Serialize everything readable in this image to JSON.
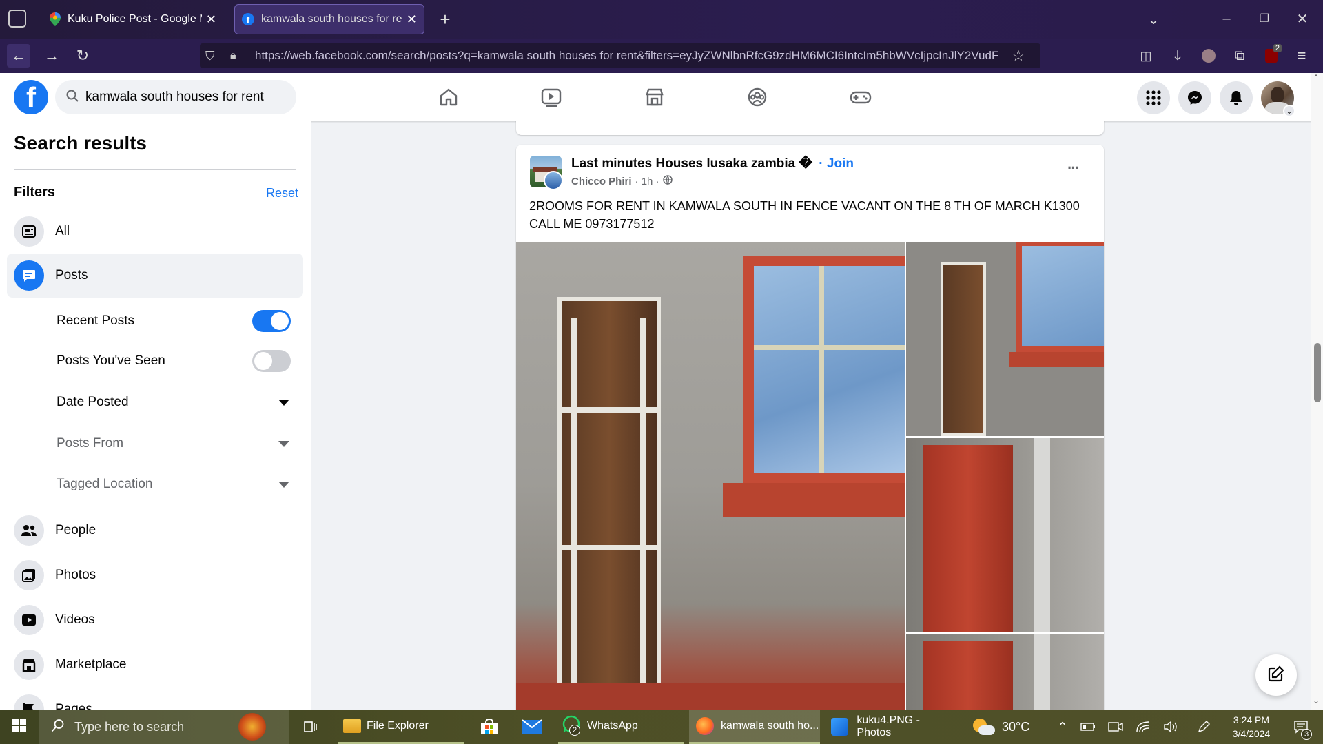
{
  "browser": {
    "tabs": [
      {
        "title": "Kuku Police Post - Google Maps",
        "icon": "google-maps-icon"
      },
      {
        "title": "kamwala south houses for rent",
        "icon": "facebook-icon"
      }
    ],
    "url": "https://web.facebook.com/search/posts?q=kamwala south houses for rent&filters=eyJyZWNlbnRfcG9zdHM6MCI6IntcIm5hbWVcIjpcInJlY2VudF",
    "url_host": "web.facebook.com",
    "extension_badge": "2"
  },
  "facebook": {
    "search_value": "kamwala south houses for rent",
    "nav_icons": [
      "home-icon",
      "watch-icon",
      "marketplace-icon",
      "groups-icon",
      "gaming-icon"
    ]
  },
  "sidebar": {
    "title": "Search results",
    "filters_label": "Filters",
    "reset_label": "Reset",
    "categories": {
      "all": "All",
      "posts": "Posts",
      "people": "People",
      "photos": "Photos",
      "videos": "Videos",
      "marketplace": "Marketplace",
      "pages": "Pages"
    },
    "sub_filters": {
      "recent_posts": {
        "label": "Recent Posts",
        "on": true
      },
      "posts_seen": {
        "label": "Posts You've Seen",
        "on": false
      },
      "date_posted": "Date Posted",
      "posts_from": "Posts From",
      "tagged_location": "Tagged Location"
    }
  },
  "post": {
    "group": "Last minutes Houses lusaka zambia �",
    "join_label": "· Join",
    "author": "Chicco Phiri",
    "time": "· 1h ·",
    "text": "2ROOMS FOR RENT IN KAMWALA SOUTH IN FENCE VACANT ON THE 8 TH OF MARCH K1300 CALL ME 0973177512",
    "more": "···"
  },
  "taskbar": {
    "search_placeholder": "Type here to search",
    "apps": {
      "file_explorer": "File Explorer",
      "whatsapp": "WhatsApp",
      "whatsapp_badge": "2",
      "firefox": "kamwala south ho...",
      "photos": "kuku4.PNG - Photos"
    },
    "weather": "30°C",
    "time": "3:24 PM",
    "date": "3/4/2024",
    "notif_count": "3"
  }
}
